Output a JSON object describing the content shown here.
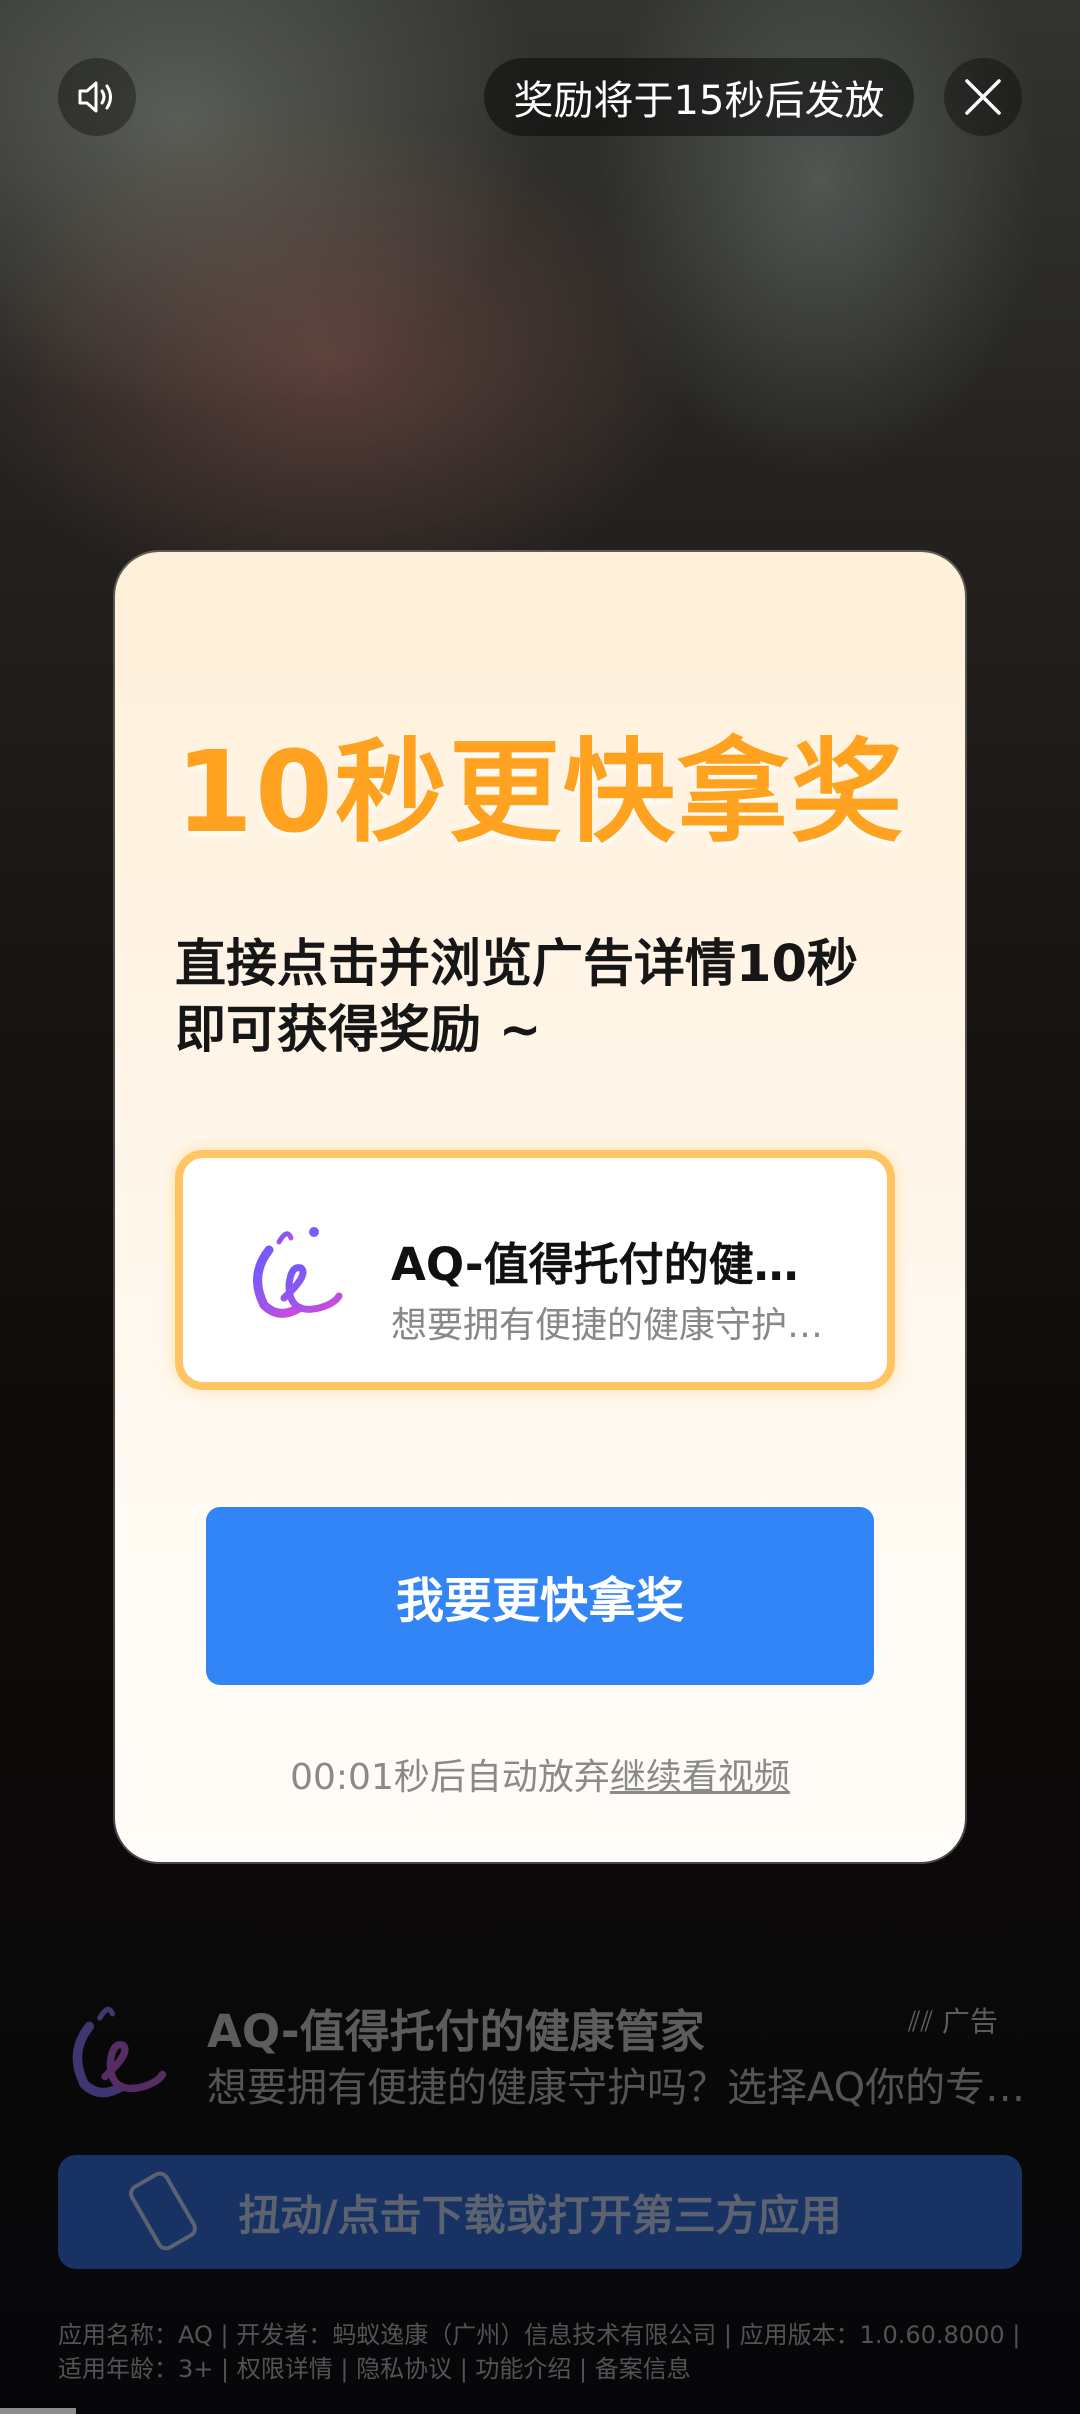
{
  "top_bar": {
    "reward_text": "奖励将于15秒后发放"
  },
  "modal": {
    "title": "10秒更快拿奖",
    "description": "直接点击并浏览广告详情10秒即可获得奖励 ~",
    "app_card": {
      "name": "AQ-值得托付的健康管家",
      "subtitle": "想要拥有便捷的健康守护吗？"
    },
    "cta_label": "我要更快拿奖",
    "countdown_prefix": "00:01秒后自动放弃",
    "continue_link": "继续看视频"
  },
  "bottom_ad": {
    "title": "AQ-值得托付的健康管家",
    "badge": "广告",
    "subtitle": "想要拥有便捷的健康守护吗？选择AQ你的专属健康管家",
    "download_label": "扭动/点击下载或打开第三方应用",
    "meta": "应用名称：AQ | 开发者：蚂蚁逸康（广州）信息技术有限公司 | 应用版本：1.0.60.8000 | 适用年龄：3+ | 权限详情 | 隐私协议 | 功能介绍 | 备案信息"
  },
  "colors": {
    "title_orange": "#ffa21f",
    "cta_blue": "#3285f6",
    "card_border": "#ffc564"
  },
  "video_progress": 0.07
}
